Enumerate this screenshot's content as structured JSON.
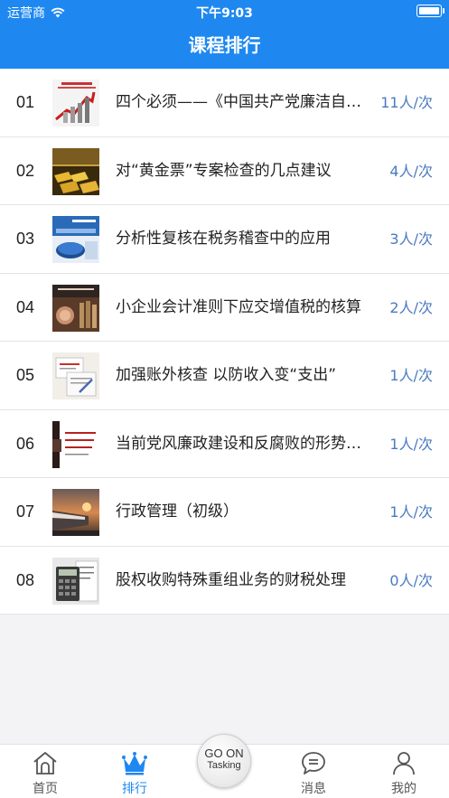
{
  "status": {
    "carrier": "运营商",
    "time": "下午9:03"
  },
  "nav": {
    "title": "课程排行"
  },
  "courses": [
    {
      "rank": "01",
      "title": "四个必须——《中国共产党廉洁自律准则》解读",
      "count": "11人/次",
      "thumb": "red-arrow-chart-thumbnail"
    },
    {
      "rank": "02",
      "title": "对“黄金票”专案检查的几点建议",
      "count": "4人/次",
      "thumb": "gold-bars-thumbnail"
    },
    {
      "rank": "03",
      "title": "分析性复核在税务稽查中的应用",
      "count": "3人/次",
      "thumb": "blue-slide-thumbnail"
    },
    {
      "rank": "04",
      "title": "小企业会计准则下应交增值税的核算",
      "count": "2人/次",
      "thumb": "coins-thumbnail"
    },
    {
      "rank": "05",
      "title": "加强账外核查 以防收入变“支出”",
      "count": "1人/次",
      "thumb": "documents-thumbnail"
    },
    {
      "rank": "06",
      "title": "当前党风廉政建设和反腐败的形势与任务",
      "count": "1人/次",
      "thumb": "red-text-slide-thumbnail"
    },
    {
      "rank": "07",
      "title": "行政管理（初级）",
      "count": "1人/次",
      "thumb": "train-sunset-thumbnail"
    },
    {
      "rank": "08",
      "title": "股权收购特殊重组业务的财税处理",
      "count": "0人/次",
      "thumb": "calculator-thumbnail"
    }
  ],
  "tabs": {
    "home": "首页",
    "ranking": "排行",
    "go_top": "GO ON",
    "go_bottom": "Tasking",
    "messages": "消息",
    "mine": "我的"
  },
  "colors": {
    "brand": "#1e88f0",
    "count_text": "#4a7ac0"
  }
}
